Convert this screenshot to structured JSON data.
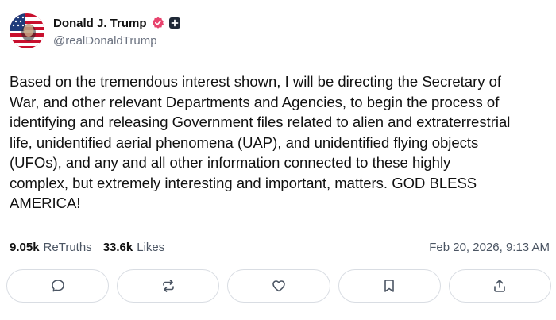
{
  "post": {
    "author": {
      "display_name": "Donald J. Trump",
      "handle": "@realDonaldTrump",
      "avatar_icon": "avatar-american-flag-portrait",
      "verified_icon": "verified-badge-icon",
      "verified_color": "#e8436d"
    },
    "body": "Based on the tremendous interest shown, I will be directing the Secretary of\nWar, and other relevant Departments and Agencies, to begin the process of\nidentifying and releasing Government files related to alien and extraterrestrial\nlife, unidentified aerial phenomena (UAP), and unidentified flying objects\n(UFOs), and any and all other information connected to these highly\ncomplex, but extremely interesting and important, matters. GOD BLESS\nAMERICA!",
    "stats": {
      "retruths_count": "9.05k",
      "retruths_label": "ReTruths",
      "likes_count": "33.6k",
      "likes_label": "Likes"
    },
    "timestamp": "Feb 20, 2026, 9:13 AM",
    "actions": [
      {
        "icon": "reply-icon"
      },
      {
        "icon": "retruth-icon"
      },
      {
        "icon": "like-heart-icon"
      },
      {
        "icon": "bookmark-icon"
      },
      {
        "icon": "share-icon"
      }
    ]
  }
}
